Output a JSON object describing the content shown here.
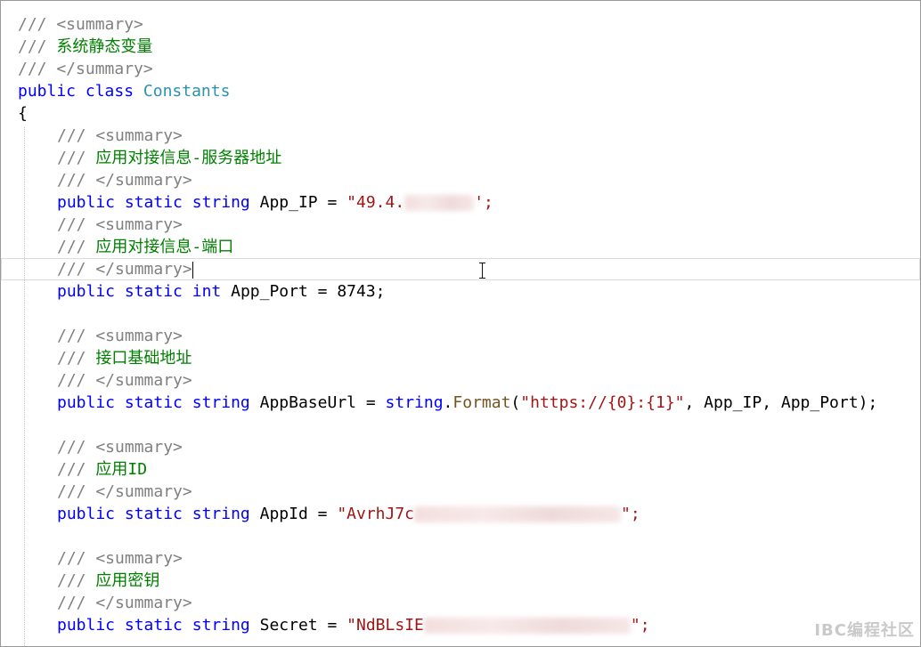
{
  "code": {
    "summary_open": "/// <summary>",
    "summary_close": "/// </summary>",
    "doc_prefix": "/// ",
    "kw_public": "public",
    "kw_class": "class",
    "kw_static": "static",
    "kw_string": "string",
    "kw_int": "int",
    "class_name": "Constants",
    "brace_open": "{",
    "class_comment": "系统静态变量",
    "ip_comment": "应用对接信息-服务器地址",
    "ip_name": "App_IP = ",
    "ip_value_visible": "\"49.4.",
    "ip_value_tail": "';",
    "port_comment": "应用对接信息-端口",
    "port_decl": "App_Port = 8743;",
    "baseurl_comment": "接口基础地址",
    "baseurl_name": "AppBaseUrl = ",
    "format_method": "Format",
    "format_paren_open": "(",
    "format_string": "\"https://{0}:{1}\"",
    "format_args": ", App_IP, App_Port);",
    "dot": ".",
    "appid_comment": "应用ID",
    "appid_name": "AppId = ",
    "appid_value_visible": "\"AvrhJ7c",
    "appid_value_tail": "\";",
    "secret_comment": "应用密钥",
    "secret_name": "Secret = ",
    "secret_value_visible": "\"NdBLsIE",
    "secret_value_tail": "\";"
  },
  "watermark": "IBC编程社区",
  "colors": {
    "comment": "#808080",
    "comment_text": "#008000",
    "keyword": "#0000ff",
    "type": "#2b91af",
    "string": "#a31515",
    "method": "#74531f"
  }
}
